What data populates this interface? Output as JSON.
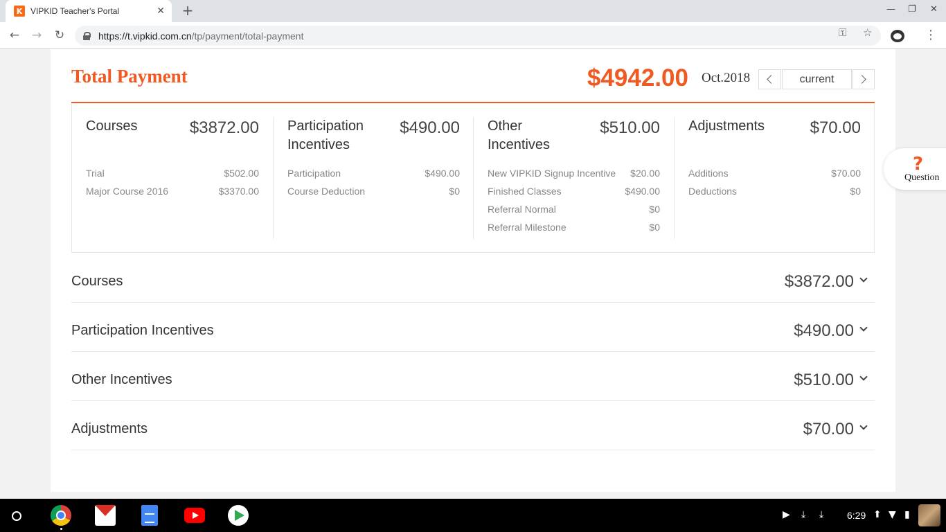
{
  "browser": {
    "tab_title": "VIPKID Teacher's Portal",
    "favicon": "K",
    "url_host": "https://t.vipkid.com.cn",
    "url_path": "/tp/payment/total-payment"
  },
  "header": {
    "title": "Total Payment",
    "total": "$4942.00",
    "month": "Oct.2018",
    "period_label": "current"
  },
  "summary": {
    "columns": [
      {
        "name": "Courses",
        "amount": "$3872.00",
        "rows": [
          {
            "label": "Trial",
            "value": "$502.00"
          },
          {
            "label": "Major Course 2016",
            "value": "$3370.00"
          }
        ]
      },
      {
        "name": "Participation Incentives",
        "amount": "$490.00",
        "rows": [
          {
            "label": "Participation",
            "value": "$490.00"
          },
          {
            "label": "Course Deduction",
            "value": "$0"
          }
        ]
      },
      {
        "name": "Other Incentives",
        "amount": "$510.00",
        "rows": [
          {
            "label": "New VIPKID Signup Incentive",
            "value": "$20.00"
          },
          {
            "label": "Finished Classes",
            "value": "$490.00"
          },
          {
            "label": "Referral Normal",
            "value": "$0"
          },
          {
            "label": "Referral Milestone",
            "value": "$0"
          }
        ]
      },
      {
        "name": "Adjustments",
        "amount": "$70.00",
        "rows": [
          {
            "label": "Additions",
            "value": "$70.00"
          },
          {
            "label": "Deductions",
            "value": "$0"
          }
        ]
      }
    ]
  },
  "sections": [
    {
      "label": "Courses",
      "amount": "$3872.00"
    },
    {
      "label": "Participation Incentives",
      "amount": "$490.00"
    },
    {
      "label": "Other Incentives",
      "amount": "$510.00"
    },
    {
      "label": "Adjustments",
      "amount": "$70.00"
    }
  ],
  "question": {
    "icon": "?",
    "label": "Question"
  },
  "shelf": {
    "time": "6:29"
  },
  "colors": {
    "accent": "#f05a22"
  }
}
